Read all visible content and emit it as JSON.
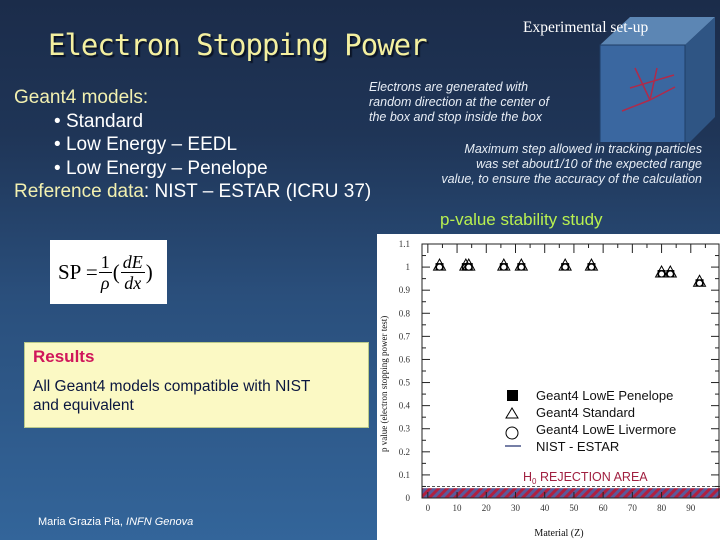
{
  "slide": {
    "title": "Electron Stopping Power",
    "models": {
      "header": "Geant4 models:",
      "items": [
        "Standard",
        "Low Energy – EEDL",
        "Low Energy – Penelope"
      ],
      "reference_label": "Reference data",
      "reference_value": ": NIST – ESTAR (ICRU 37)"
    },
    "setup": {
      "label": "Experimental set-up",
      "description_lines": [
        "Electrons are generated with",
        "random direction at the center of",
        "the box and stop inside the box"
      ],
      "step_lines": [
        "Maximum step allowed in tracking particles",
        "was set  about1/10 of the expected range",
        "value, to ensure the accuracy of the calculation"
      ],
      "icon": "cube-with-tracks-icon"
    },
    "formula": {
      "lhs": "SP =",
      "num1": "1",
      "den1": "ρ",
      "num2": "dE",
      "den2": "dx"
    },
    "results": {
      "heading": "Results",
      "body_lines": [
        "All Geant4 models compatible with NIST",
        "and equivalent"
      ]
    },
    "pvalue_title": "p-value stability study",
    "footer": {
      "author": "Maria Grazia Pia, ",
      "institute": "INFN Genova"
    },
    "colors": {
      "title": "#f4f0a0",
      "subtitle": "#b8f050",
      "results_heading": "#d0165a",
      "rejection": "#a02040"
    }
  },
  "chart_data": {
    "type": "scatter",
    "title": "p-value stability study",
    "xlabel": "Material (Z)",
    "ylabel": "p value (electron stopping power test)",
    "xlim": [
      -2,
      100
    ],
    "ylim": [
      0,
      1.1
    ],
    "xticks": [
      0,
      10,
      20,
      30,
      40,
      50,
      60,
      70,
      80,
      90
    ],
    "yticks": [
      0,
      0.1,
      0.2,
      0.3,
      0.4,
      0.5,
      0.6,
      0.7,
      0.8,
      0.9,
      1,
      1.1
    ],
    "ytick_labels": [
      "0",
      "0.1",
      "0.2",
      "0.3",
      "0.4",
      "0.5",
      "0.6",
      "0.7",
      "0.8",
      "0.9",
      "1",
      "1.1"
    ],
    "x": [
      4,
      13,
      14,
      26,
      32,
      47,
      56,
      80,
      83,
      93
    ],
    "series": [
      {
        "name": "Geant4 LowE Penelope",
        "marker": "square",
        "values": [
          1.0,
          1.0,
          1.0,
          1.0,
          1.0,
          1.0,
          1.0,
          0.97,
          0.97,
          0.93
        ]
      },
      {
        "name": "Geant4 Standard",
        "marker": "triangle",
        "values": [
          1.0,
          1.0,
          1.0,
          1.0,
          1.0,
          1.0,
          1.0,
          0.97,
          0.97,
          0.93
        ]
      },
      {
        "name": "Geant4 LowE Livermore",
        "marker": "circle",
        "values": [
          1.0,
          1.0,
          1.0,
          1.0,
          1.0,
          1.0,
          1.0,
          0.97,
          0.97,
          0.93
        ]
      }
    ],
    "reference_line": {
      "name": "NIST - ESTAR"
    },
    "rejection_area": {
      "label": "H0 REJECTION AREA",
      "label_main": "H",
      "label_sub": "0",
      "label_rest": " REJECTION AREA",
      "threshold": 0.05
    },
    "legend": "center-right",
    "grid": false
  }
}
